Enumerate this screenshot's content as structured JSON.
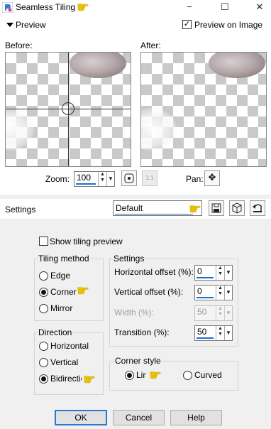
{
  "window": {
    "title": "Seamless Tiling",
    "minimize": "−",
    "maximize": "☐",
    "close": "✕"
  },
  "preview": {
    "header_label": "Preview",
    "preview_on_image_label": "Preview on Image",
    "preview_on_image_checked": true,
    "before_label": "Before:",
    "after_label": "After:",
    "zoom_label": "Zoom:",
    "zoom_value": "100",
    "pan_label": "Pan:"
  },
  "settings": {
    "label": "Settings",
    "preset_value": "Default",
    "show_tiling_preview_label": "Show tiling preview",
    "show_tiling_preview_checked": false
  },
  "tiling_method": {
    "title": "Tiling method",
    "options": [
      "Edge",
      "Corner",
      "Mirror"
    ],
    "selected": "Corner"
  },
  "settings_group": {
    "title": "Settings",
    "horizontal_offset_label": "Horizontal offset (%):",
    "horizontal_offset_value": "0",
    "vertical_offset_label": "Vertical offset (%):",
    "vertical_offset_value": "0",
    "width_label": "Width (%):",
    "width_value": "50",
    "transition_label": "Transition (%):",
    "transition_value": "50"
  },
  "direction": {
    "title": "Direction",
    "options": [
      "Horizontal",
      "Vertical",
      "Bidirectional"
    ],
    "selected": "Bidirectional"
  },
  "corner_style": {
    "title": "Corner style",
    "options": [
      "Linear",
      "Curved"
    ],
    "selected": "Linear"
  },
  "buttons": {
    "ok": "OK",
    "cancel": "Cancel",
    "help": "Help"
  },
  "colors": {
    "accent": "#1e6fd0",
    "pointer_hand": "#e8c200"
  }
}
